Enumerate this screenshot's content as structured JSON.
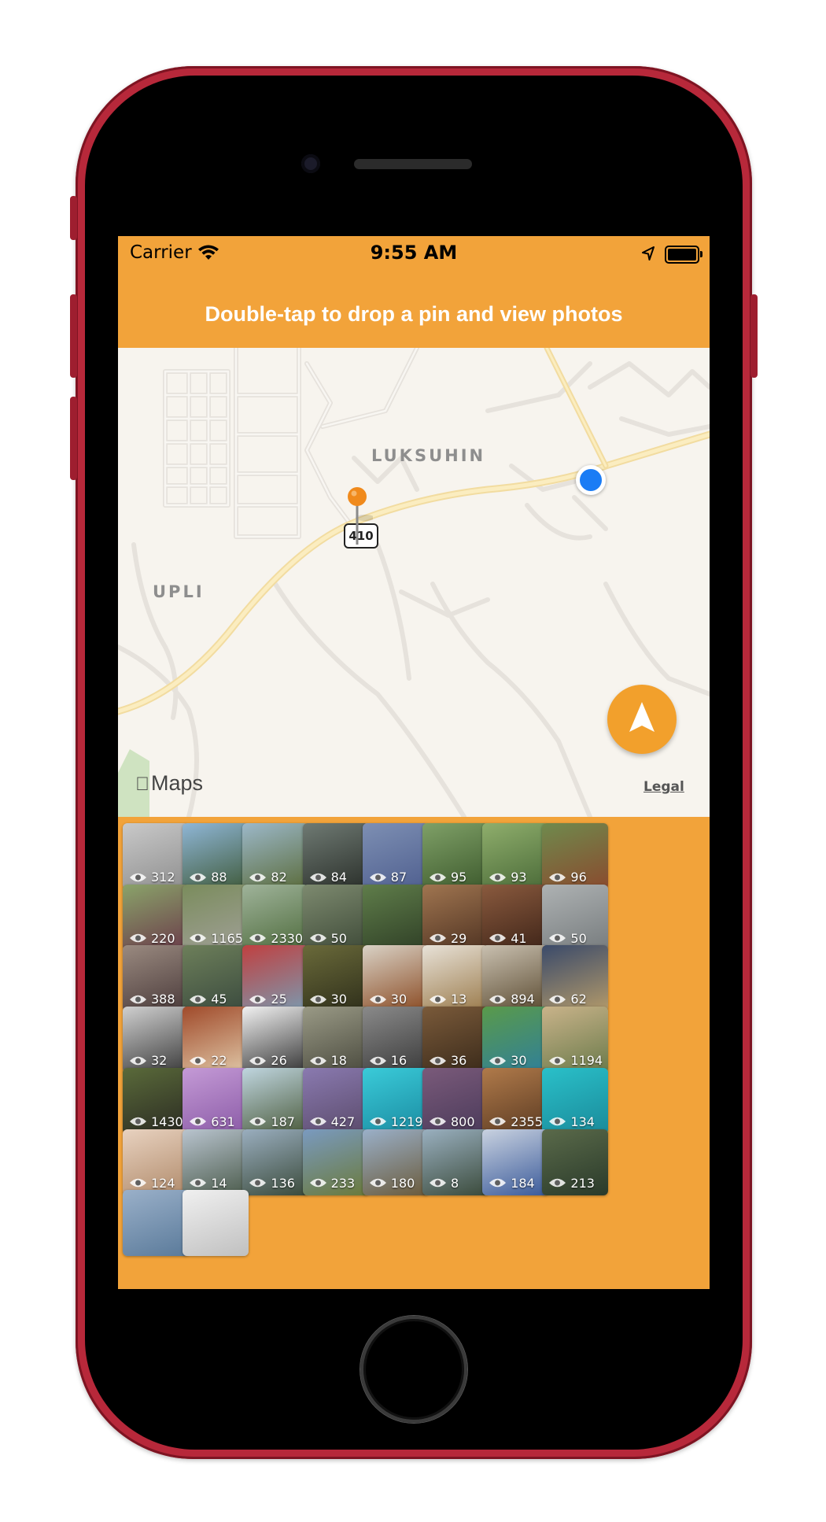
{
  "status_bar": {
    "carrier": "Carrier",
    "time": "9:55 AM"
  },
  "nav": {
    "title": "Double-tap to drop a pin and view photos"
  },
  "map": {
    "labels": {
      "area_1": "LUKSUHIN",
      "area_2": "UPLI"
    },
    "route_shield": "410",
    "attribution": "Maps",
    "legal": "Legal"
  },
  "icons": [
    "wifi-icon",
    "location-arrow-icon",
    "battery-icon",
    "pin-icon",
    "user-location-dot",
    "navigation-arrow-icon",
    "eye-icon"
  ],
  "photos": [
    {
      "views": "312",
      "colors": [
        "#c9c9c9",
        "#8e8e8e"
      ]
    },
    {
      "views": "88",
      "colors": [
        "#8fb6d6",
        "#3f5a3a"
      ]
    },
    {
      "views": "82",
      "colors": [
        "#9cb8c9",
        "#5a6b3a"
      ]
    },
    {
      "views": "84",
      "colors": [
        "#6f7a73",
        "#2a2f2a"
      ]
    },
    {
      "views": "87",
      "colors": [
        "#7d8fb3",
        "#4f5f8f"
      ]
    },
    {
      "views": "95",
      "colors": [
        "#7fa067",
        "#3d5a2d"
      ]
    },
    {
      "views": "93",
      "colors": [
        "#8fae6c",
        "#4a6a38"
      ]
    },
    {
      "views": "96",
      "colors": [
        "#6f8a4d",
        "#8a4a2e"
      ]
    },
    {
      "views": "220",
      "colors": [
        "#8aa36a",
        "#6b3b4a"
      ]
    },
    {
      "views": "1165",
      "colors": [
        "#7a8c5c",
        "#a1a098"
      ]
    },
    {
      "views": "2330",
      "colors": [
        "#9fb39a",
        "#4e6b3c"
      ]
    },
    {
      "views": "50",
      "colors": [
        "#7d8a6f",
        "#3e4a38"
      ]
    },
    {
      "views": "",
      "colors": [
        "#5f7d4a",
        "#2f3f26"
      ]
    },
    {
      "views": "29",
      "colors": [
        "#a07550",
        "#4f3322"
      ]
    },
    {
      "views": "41",
      "colors": [
        "#8a5a3e",
        "#3e2418"
      ]
    },
    {
      "views": "50",
      "colors": [
        "#aeb2b3",
        "#777c7e"
      ]
    },
    {
      "views": "388",
      "colors": [
        "#9a8a80",
        "#4a3a3a"
      ]
    },
    {
      "views": "45",
      "colors": [
        "#6d7f5a",
        "#3a4a3e"
      ]
    },
    {
      "views": "25",
      "colors": [
        "#c04040",
        "#7a9ab0"
      ]
    },
    {
      "views": "30",
      "colors": [
        "#6a6a3a",
        "#2e2e1a"
      ]
    },
    {
      "views": "30",
      "colors": [
        "#d9d2c6",
        "#8a4a22"
      ]
    },
    {
      "views": "13",
      "colors": [
        "#e8e2d8",
        "#9a7a4a"
      ]
    },
    {
      "views": "894",
      "colors": [
        "#c9c0b0",
        "#5a4a30"
      ]
    },
    {
      "views": "62",
      "colors": [
        "#3a4a6a",
        "#b39a6a"
      ]
    },
    {
      "views": "32",
      "colors": [
        "#d0d0d0",
        "#3a3a3a"
      ]
    },
    {
      "views": "22",
      "colors": [
        "#a04a2a",
        "#e0c8a8"
      ]
    },
    {
      "views": "26",
      "colors": [
        "#f2f2f2",
        "#333333"
      ]
    },
    {
      "views": "18",
      "colors": [
        "#9a9a86",
        "#4a4a3e"
      ]
    },
    {
      "views": "16",
      "colors": [
        "#8a8a8a",
        "#3a3a3a"
      ]
    },
    {
      "views": "36",
      "colors": [
        "#7a5a3a",
        "#3a2a1a"
      ]
    },
    {
      "views": "30",
      "colors": [
        "#5a9a4a",
        "#2f7f9a"
      ]
    },
    {
      "views": "1194",
      "colors": [
        "#c9b38a",
        "#6a7a4a"
      ]
    },
    {
      "views": "1430",
      "colors": [
        "#5a6a3a",
        "#2a2a22"
      ]
    },
    {
      "views": "631",
      "colors": [
        "#c49ad6",
        "#8a5aa6"
      ]
    },
    {
      "views": "187",
      "colors": [
        "#c0d6e0",
        "#4a5a3a"
      ]
    },
    {
      "views": "427",
      "colors": [
        "#8a7ab0",
        "#5a4a6a"
      ]
    },
    {
      "views": "1219",
      "colors": [
        "#3acbd9",
        "#1a8aa0"
      ]
    },
    {
      "views": "800",
      "colors": [
        "#7a5a7a",
        "#4a3a5a"
      ]
    },
    {
      "views": "2355",
      "colors": [
        "#b07a4a",
        "#5a3a22"
      ]
    },
    {
      "views": "134",
      "colors": [
        "#2ac0c9",
        "#1a8a9a"
      ]
    },
    {
      "views": "124",
      "colors": [
        "#e8d2c0",
        "#b08a6a"
      ]
    },
    {
      "views": "14",
      "colors": [
        "#b9c4cf",
        "#4a5a4a"
      ]
    },
    {
      "views": "136",
      "colors": [
        "#9aaebf",
        "#3a4a3a"
      ]
    },
    {
      "views": "233",
      "colors": [
        "#7a9ac0",
        "#6a7a3a"
      ]
    },
    {
      "views": "180",
      "colors": [
        "#9ab0c9",
        "#6a5a3a"
      ]
    },
    {
      "views": "8",
      "colors": [
        "#9ab0c0",
        "#3a4a3a"
      ]
    },
    {
      "views": "184",
      "colors": [
        "#c9d2e0",
        "#3a5a9a"
      ]
    },
    {
      "views": "213",
      "colors": [
        "#5a6a4a",
        "#2a3a2a"
      ]
    },
    {
      "views": "",
      "colors": [
        "#9ab0c9",
        "#5a7a9a"
      ]
    },
    {
      "views": "",
      "colors": [
        "#f0f0f0",
        "#c0c0c0"
      ]
    }
  ]
}
